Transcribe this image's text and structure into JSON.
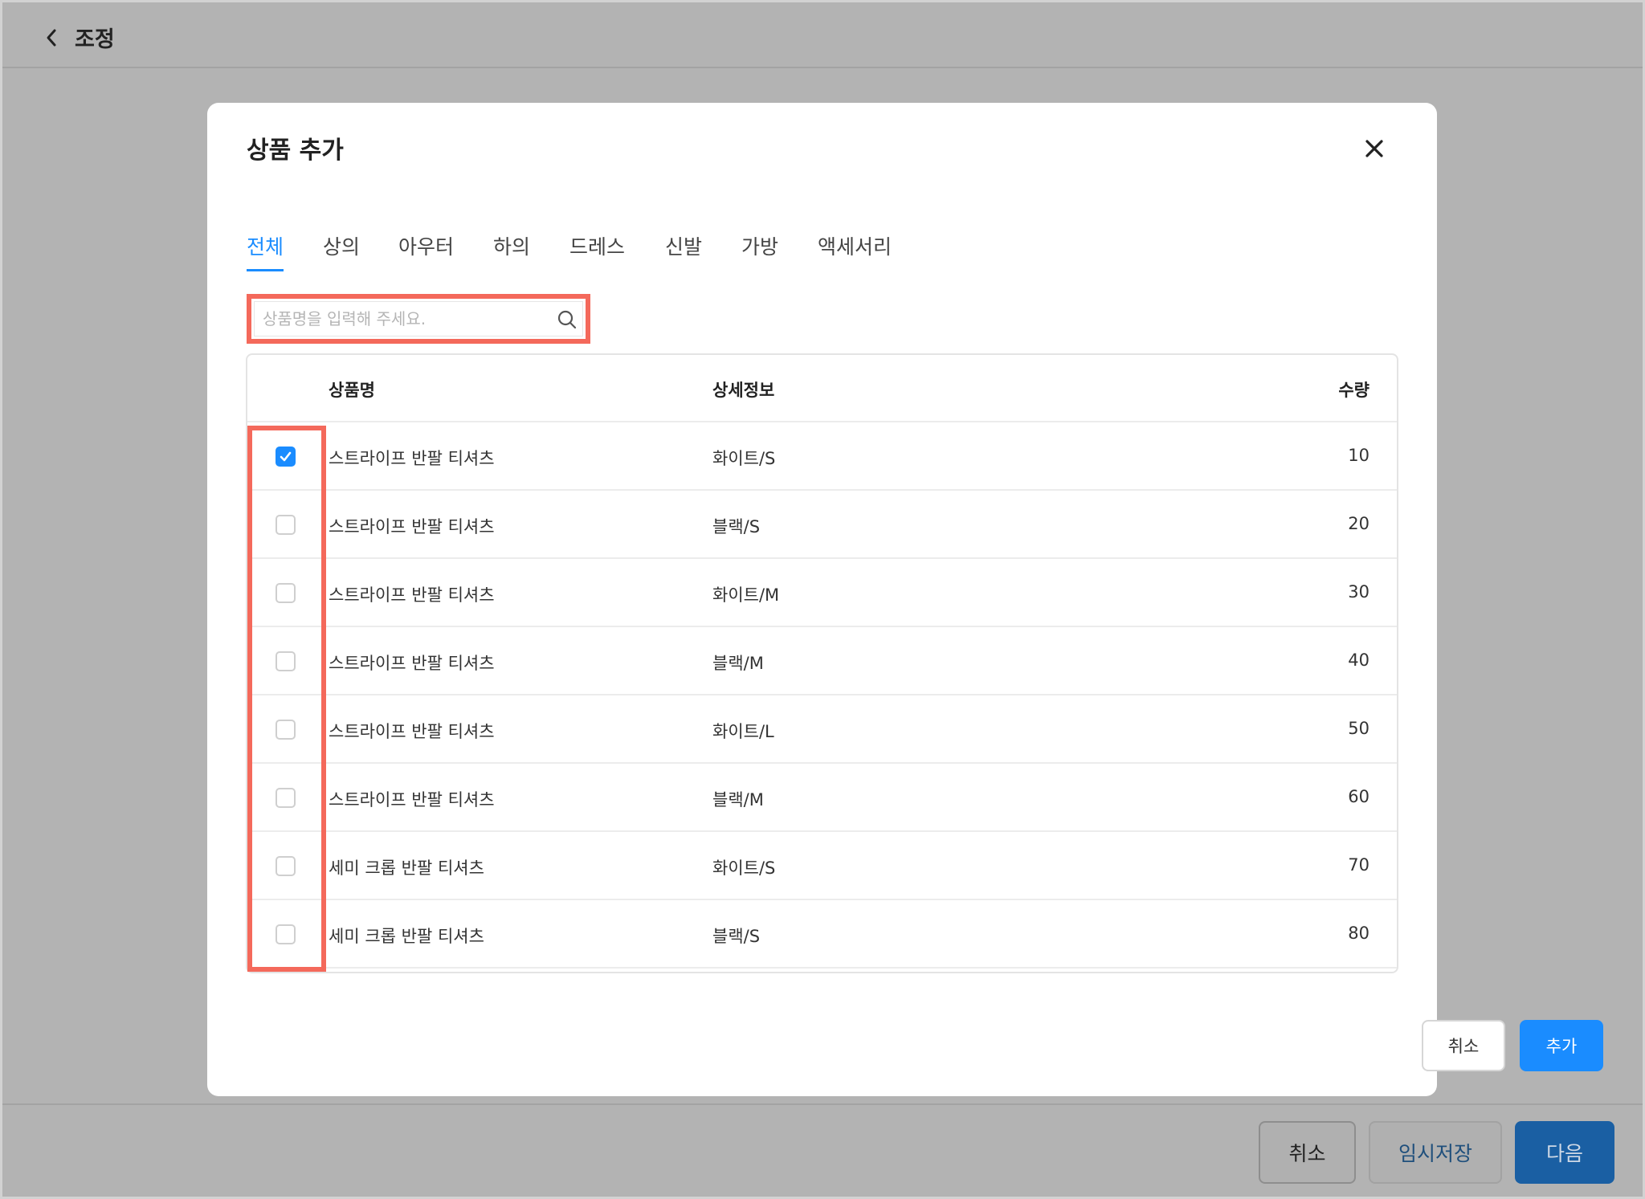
{
  "header": {
    "title": "조정"
  },
  "footer": {
    "cancel": "취소",
    "temp_save": "임시저장",
    "next": "다음"
  },
  "modal": {
    "title": "상품 추가",
    "tabs": [
      {
        "label": "전체",
        "active": true
      },
      {
        "label": "상의"
      },
      {
        "label": "아우터"
      },
      {
        "label": "하의"
      },
      {
        "label": "드레스"
      },
      {
        "label": "신발"
      },
      {
        "label": "가방"
      },
      {
        "label": "액세서리"
      }
    ],
    "search": {
      "placeholder": "상품명을 입력해 주세요."
    },
    "table": {
      "columns": {
        "name": "상품명",
        "detail": "상세정보",
        "qty": "수량"
      },
      "rows": [
        {
          "name": "스트라이프 반팔 티셔츠",
          "detail": "화이트/S",
          "qty": "10",
          "checked": true
        },
        {
          "name": "스트라이프 반팔 티셔츠",
          "detail": "블랙/S",
          "qty": "20",
          "checked": false
        },
        {
          "name": "스트라이프 반팔 티셔츠",
          "detail": "화이트/M",
          "qty": "30",
          "checked": false
        },
        {
          "name": "스트라이프 반팔 티셔츠",
          "detail": "블랙/M",
          "qty": "40",
          "checked": false
        },
        {
          "name": "스트라이프 반팔 티셔츠",
          "detail": "화이트/L",
          "qty": "50",
          "checked": false
        },
        {
          "name": "스트라이프 반팔 티셔츠",
          "detail": "블랙/M",
          "qty": "60",
          "checked": false
        },
        {
          "name": "세미 크롭 반팔 티셔츠",
          "detail": "화이트/S",
          "qty": "70",
          "checked": false
        },
        {
          "name": "세미 크롭 반팔 티셔츠",
          "detail": "블랙/S",
          "qty": "80",
          "checked": false
        }
      ]
    },
    "buttons": {
      "cancel": "취소",
      "add": "추가"
    }
  },
  "colors": {
    "accent": "#1a8cff",
    "highlight": "#f4695b",
    "overlay": "#b3b3b3"
  }
}
